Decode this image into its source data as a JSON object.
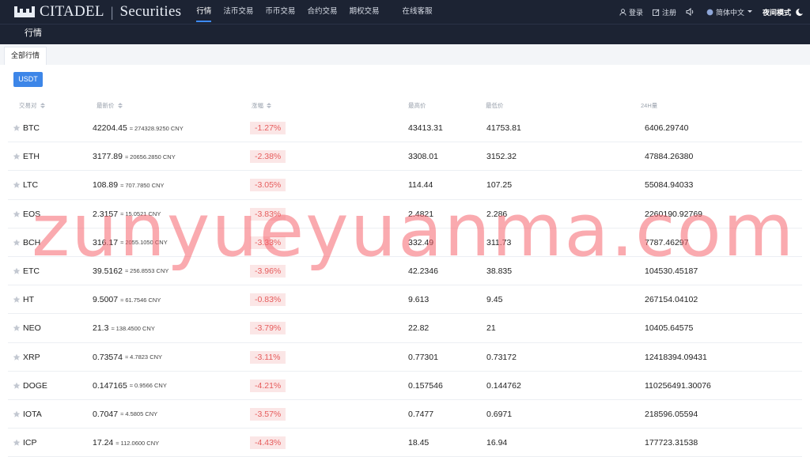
{
  "brand": {
    "name": "CITADEL",
    "separator": "|",
    "suffix": "Securities"
  },
  "nav": [
    {
      "label": "行情",
      "active": true
    },
    {
      "label": "法币交易"
    },
    {
      "label": "币币交易"
    },
    {
      "label": "合约交易"
    },
    {
      "label": "期权交易"
    },
    {
      "label": "在线客服"
    }
  ],
  "tools": {
    "login": "登录",
    "register": "注册",
    "language": "简体中文",
    "night_mode": "夜间模式"
  },
  "subnav": {
    "title": "行情"
  },
  "filter": {
    "tab": "全部行情",
    "currency": "USDT"
  },
  "columns": {
    "pair": "交易对",
    "last": "最新价",
    "change": "涨幅",
    "high": "最高价",
    "low": "最低价",
    "volume": "24H量"
  },
  "rows": [
    {
      "pair": "BTC",
      "price": "42204.45",
      "cny": "≈ 274328.9250 CNY",
      "change": "-1.27%",
      "high": "43413.31",
      "low": "41753.81",
      "volume": "6406.29740"
    },
    {
      "pair": "ETH",
      "price": "3177.89",
      "cny": "≈ 20656.2850 CNY",
      "change": "-2.38%",
      "high": "3308.01",
      "low": "3152.32",
      "volume": "47884.26380"
    },
    {
      "pair": "LTC",
      "price": "108.89",
      "cny": "≈ 707.7850 CNY",
      "change": "-3.05%",
      "high": "114.44",
      "low": "107.25",
      "volume": "55084.94033"
    },
    {
      "pair": "EOS",
      "price": "2.3157",
      "cny": "≈ 15.0521 CNY",
      "change": "-3.83%",
      "high": "2.4821",
      "low": "2.286",
      "volume": "2260190.92769"
    },
    {
      "pair": "BCH",
      "price": "316.17",
      "cny": "≈ 2055.1050 CNY",
      "change": "-3.33%",
      "high": "332.49",
      "low": "311.73",
      "volume": "7787.46297"
    },
    {
      "pair": "ETC",
      "price": "39.5162",
      "cny": "≈ 256.8553 CNY",
      "change": "-3.96%",
      "high": "42.2346",
      "low": "38.835",
      "volume": "104530.45187"
    },
    {
      "pair": "HT",
      "price": "9.5007",
      "cny": "≈ 61.7546 CNY",
      "change": "-0.83%",
      "high": "9.613",
      "low": "9.45",
      "volume": "267154.04102"
    },
    {
      "pair": "NEO",
      "price": "21.3",
      "cny": "≈ 138.4500 CNY",
      "change": "-3.79%",
      "high": "22.82",
      "low": "21",
      "volume": "10405.64575"
    },
    {
      "pair": "XRP",
      "price": "0.73574",
      "cny": "≈ 4.7823 CNY",
      "change": "-3.11%",
      "high": "0.77301",
      "low": "0.73172",
      "volume": "12418394.09431"
    },
    {
      "pair": "DOGE",
      "price": "0.147165",
      "cny": "≈ 0.9566 CNY",
      "change": "-4.21%",
      "high": "0.157546",
      "low": "0.144762",
      "volume": "110256491.30076"
    },
    {
      "pair": "IOTA",
      "price": "0.7047",
      "cny": "≈ 4.5805 CNY",
      "change": "-3.57%",
      "high": "0.7477",
      "low": "0.6971",
      "volume": "218596.05594"
    },
    {
      "pair": "ICP",
      "price": "17.24",
      "cny": "≈ 112.0600 CNY",
      "change": "-4.43%",
      "high": "18.45",
      "low": "16.94",
      "volume": "177723.31538"
    }
  ],
  "watermark": "zunyueyuanma.com",
  "colors": {
    "topbar": "#1c2333",
    "accent": "#3d86e8",
    "negative": "#e65c5c",
    "negative_bg": "#fbe6e6"
  }
}
